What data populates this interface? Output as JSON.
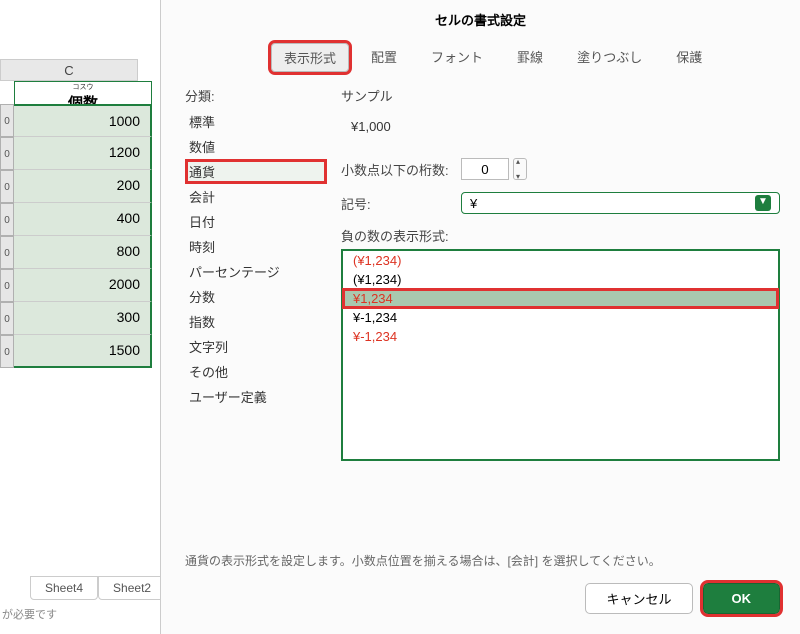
{
  "sheet": {
    "col_letter": "C",
    "header_ruby": "コスウ",
    "header": "個数",
    "values": [
      "1000",
      "1200",
      "200",
      "400",
      "800",
      "2000",
      "300",
      "1500"
    ],
    "tabs": [
      "Sheet4",
      "Sheet2"
    ],
    "footer": "が必要です"
  },
  "dialog": {
    "title": "セルの書式設定",
    "tabs": [
      "表示形式",
      "配置",
      "フォント",
      "罫線",
      "塗りつぶし",
      "保護"
    ],
    "active_tab": 0,
    "category_label": "分類:",
    "categories": [
      "標準",
      "数値",
      "通貨",
      "会計",
      "日付",
      "時刻",
      "パーセンテージ",
      "分数",
      "指数",
      "文字列",
      "その他",
      "ユーザー定義"
    ],
    "selected_category": 2,
    "sample_label": "サンプル",
    "sample_value": "¥1,000",
    "decimal_label": "小数点以下の桁数:",
    "decimal_value": "0",
    "symbol_label": "記号:",
    "symbol_value": "¥",
    "negative_label": "負の数の表示形式:",
    "negative_items": [
      {
        "text": "(¥1,234)",
        "red": true
      },
      {
        "text": "(¥1,234)",
        "red": false
      },
      {
        "text": "¥1,234",
        "red": true,
        "selected": true
      },
      {
        "text": "¥-1,234",
        "red": false
      },
      {
        "text": "¥-1,234",
        "red": true
      }
    ],
    "hint": "通貨の表示形式を設定します。小数点位置を揃える場合は、[会計] を選択してください。",
    "cancel": "キャンセル",
    "ok": "OK"
  }
}
